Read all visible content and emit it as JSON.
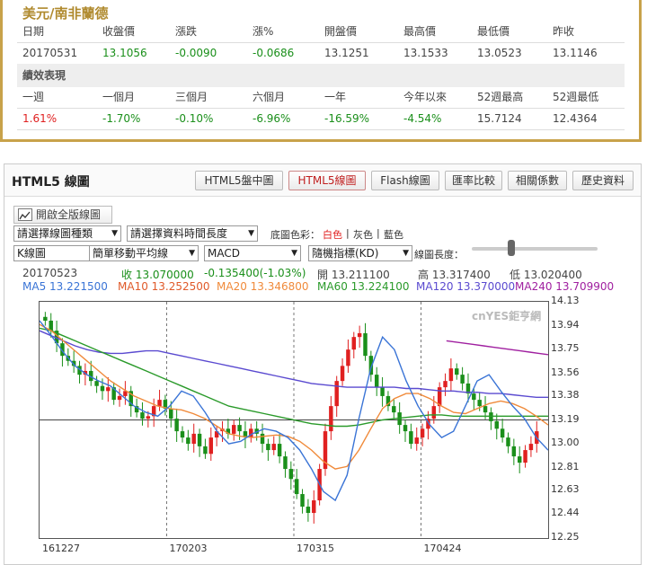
{
  "quote": {
    "title": "美元/南非蘭德",
    "headers": [
      "日期",
      "收盤價",
      "漲跌",
      "漲%",
      "開盤價",
      "最高價",
      "最低價",
      "昨收"
    ],
    "values": [
      "20170531",
      "13.1056",
      "-0.0090",
      "-0.0686",
      "13.1251",
      "13.1533",
      "13.0523",
      "13.1146"
    ],
    "perf_title": "績效表現",
    "perf_headers": [
      "一週",
      "一個月",
      "三個月",
      "六個月",
      "一年",
      "今年以來",
      "52週最高",
      "52週最低"
    ],
    "perf_values": [
      "1.61%",
      "-1.70%",
      "-0.10%",
      "-6.96%",
      "-16.59%",
      "-4.54%",
      "15.7124",
      "12.4364"
    ]
  },
  "chart": {
    "title": "HTML5 線圖",
    "tabs": [
      "HTML5盤中圖",
      "HTML5線圖",
      "Flash線圖",
      "匯率比較",
      "相關係數",
      "歷史資料"
    ],
    "active_tab": "HTML5線圖",
    "full_button": "開啟全版線圖",
    "select_chart_type": "請選擇線圖種類",
    "select_period": "請選擇資料時間長度",
    "bg_label": "底圖色彩：",
    "bg_white": "白色",
    "bg_gray": "灰色",
    "bg_blue": "藍色",
    "sel_kline": "K線圖",
    "sel_ma": "簡單移動平均線",
    "sel_macd": "MACD",
    "sel_kd": "隨機指標(KD)",
    "len_label": "線圖長度：",
    "info_date": "20170523",
    "info_close": "收 13.070000",
    "info_change": "-0.135400(-1.03%)",
    "info_open": "開 13.211100",
    "info_high": "高 13.317400",
    "info_low": "低 13.020400",
    "ma5": "MA5 13.221500",
    "ma10": "MA10 13.252500",
    "ma20": "MA20 13.346800",
    "ma60": "MA60 13.224100",
    "ma120": "MA120 13.370000",
    "ma240": "MA240 13.709900",
    "watermark": "cnYES鉅亨網",
    "colors": {
      "ma5": "#3a74d6",
      "ma10": "#e05a2a",
      "ma20": "#f08a3a",
      "ma60": "#2a9a2a",
      "ma120": "#5a4ad0",
      "ma240": "#a020a0",
      "up": "#e02020",
      "down": "#1a8f1a"
    }
  },
  "chart_data": {
    "type": "candlestick",
    "ylim": [
      12.25,
      14.13
    ],
    "yticks": [
      "14.13",
      "13.94",
      "13.75",
      "13.56",
      "13.38",
      "13.19",
      "13.00",
      "12.81",
      "12.63",
      "12.44",
      "12.25"
    ],
    "xticks": [
      "161227",
      "170203",
      "170315",
      "170424"
    ],
    "ma5": [
      13.98,
      13.86,
      13.73,
      13.62,
      13.55,
      13.5,
      13.46,
      13.38,
      13.3,
      13.25,
      13.22,
      13.3,
      13.42,
      13.38,
      13.25,
      13.1,
      13.0,
      13.02,
      13.08,
      13.12,
      13.1,
      13.05,
      12.95,
      12.8,
      12.62,
      12.55,
      12.75,
      13.2,
      13.6,
      13.85,
      13.75,
      13.5,
      13.3,
      13.15,
      13.05,
      13.1,
      13.3,
      13.5,
      13.55,
      13.42,
      13.3,
      13.2,
      13.05,
      12.95
    ],
    "ma20": [
      13.95,
      13.9,
      13.82,
      13.74,
      13.66,
      13.58,
      13.5,
      13.44,
      13.38,
      13.34,
      13.3,
      13.28,
      13.27,
      13.24,
      13.2,
      13.14,
      13.08,
      13.06,
      13.05,
      13.06,
      13.07,
      13.06,
      13.02,
      12.95,
      12.86,
      12.8,
      12.82,
      12.95,
      13.12,
      13.28,
      13.36,
      13.4,
      13.4,
      13.36,
      13.3,
      13.25,
      13.24,
      13.28,
      13.32,
      13.34,
      13.32,
      13.28,
      13.22,
      13.15
    ],
    "ma60": [
      13.92,
      13.9,
      13.86,
      13.82,
      13.78,
      13.74,
      13.7,
      13.66,
      13.62,
      13.58,
      13.54,
      13.5,
      13.46,
      13.42,
      13.38,
      13.34,
      13.3,
      13.28,
      13.26,
      13.24,
      13.22,
      13.2,
      13.18,
      13.16,
      13.15,
      13.14,
      13.14,
      13.15,
      13.17,
      13.19,
      13.2,
      13.21,
      13.22,
      13.23,
      13.23,
      13.22,
      13.22,
      13.22,
      13.22,
      13.22,
      13.22,
      13.22,
      13.22,
      13.22
    ],
    "ma120": [
      13.9,
      13.86,
      13.82,
      13.78,
      13.75,
      13.73,
      13.72,
      13.72,
      13.73,
      13.74,
      13.74,
      13.72,
      13.7,
      13.68,
      13.66,
      13.64,
      13.62,
      13.6,
      13.58,
      13.56,
      13.54,
      13.52,
      13.5,
      13.48,
      13.47,
      13.46,
      13.45,
      13.45,
      13.45,
      13.45,
      13.45,
      13.44,
      13.44,
      13.43,
      13.42,
      13.42,
      13.41,
      13.41,
      13.4,
      13.4,
      13.39,
      13.38,
      13.37,
      13.37
    ],
    "ma240": [
      13.82,
      13.81,
      13.8,
      13.79,
      13.78,
      13.77,
      13.76,
      13.75,
      13.74,
      13.73,
      13.72,
      13.71
    ],
    "closes": [
      13.98,
      13.9,
      13.8,
      13.7,
      13.66,
      13.62,
      13.55,
      13.58,
      13.5,
      13.46,
      13.42,
      13.45,
      13.35,
      13.38,
      13.42,
      13.3,
      13.25,
      13.2,
      13.22,
      13.3,
      13.35,
      13.28,
      13.2,
      13.1,
      13.05,
      13.0,
      13.08,
      12.98,
      12.92,
      13.05,
      13.1,
      13.12,
      13.08,
      13.15,
      13.1,
      13.05,
      13.12,
      13.08,
      13.0,
      12.95,
      13.0,
      12.9,
      12.8,
      12.72,
      12.6,
      12.5,
      12.45,
      12.55,
      12.8,
      13.1,
      13.3,
      13.5,
      13.62,
      13.75,
      13.85,
      13.88,
      13.7,
      13.55,
      13.45,
      13.38,
      13.3,
      13.25,
      13.15,
      13.1,
      13.0,
      13.05,
      13.12,
      13.2,
      13.3,
      13.45,
      13.5,
      13.6,
      13.55,
      13.48,
      13.4,
      13.35,
      13.3,
      13.25,
      13.18,
      13.12,
      13.05,
      12.98,
      12.9,
      12.85,
      12.95,
      13.0,
      13.1
    ]
  }
}
